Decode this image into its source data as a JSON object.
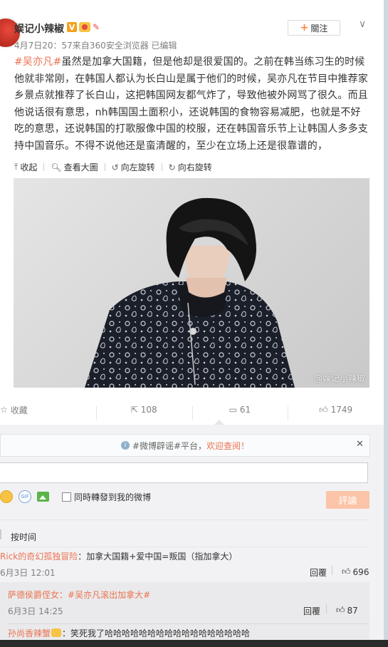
{
  "post": {
    "username": "娱记小辣椒",
    "verified_badge": "V",
    "meta": "4月7日20：57来自360安全浏览器  已编辑",
    "follow_label": "關注",
    "tag": "#吴亦凡#",
    "text": "虽然是加拿大国籍，但是他却是很爱国的。之前在韩当练习生的时候他就非常刚，在韩国人都认为长白山是属于他们的时候，吴亦凡在节目中推荐家乡景点就推荐了长白山，这把韩国网友都气炸了，导致他被外网骂了很久。而且他说话很有意思，nh韩国国土面积小，还说韩国的食物容易减肥，也就是不好吃的意思，还说韩国的打歌服像中国的校服，还在韩国音乐节上让韩国人多多支持中国音乐。不得不说他还是蛮清醒的，至少在立场上还是很靠谱的，",
    "watermark": "@娱记小辣椒"
  },
  "image_toolbar": {
    "collapse": "收起",
    "view_large": "查看大圖",
    "rotate_left": "向左旋转",
    "rotate_right": "向右旋转"
  },
  "actions": {
    "favorite": "收藏",
    "repost_count": "108",
    "comment_count": "61",
    "like_count": "1749"
  },
  "comment_box": {
    "notice_prefix": "#微博辟谣#平台，",
    "notice_link": "欢迎查阅！",
    "repost_checkbox_label": "同時轉發到我的微博",
    "submit_label": "評論",
    "sort_label": "按时间"
  },
  "comments": [
    {
      "user": "Rick的奇幻孤独冒险",
      "text": "：加拿大国籍+爱中国=叛国（指加拿大）",
      "time": "6月3日 12:01",
      "reply_label": "回覆",
      "likes": "696"
    }
  ],
  "replies": [
    {
      "user": "萨德侯爵侄女",
      "text": "：#吴亦凡滚出加拿大#",
      "time": "6月3日 14:25",
      "reply_label": "回覆",
      "likes": "87"
    },
    {
      "user": "孙尚香辣蟹",
      "text": "：笑死我了哈哈哈哈哈哈哈哈哈哈哈哈哈哈哈哈哈"
    }
  ],
  "colors": {
    "accent": "#eb7350",
    "follow_plus": "#ff8140",
    "submit_disabled": "#fcc4a8",
    "page_bg": "#dfe7ef"
  }
}
